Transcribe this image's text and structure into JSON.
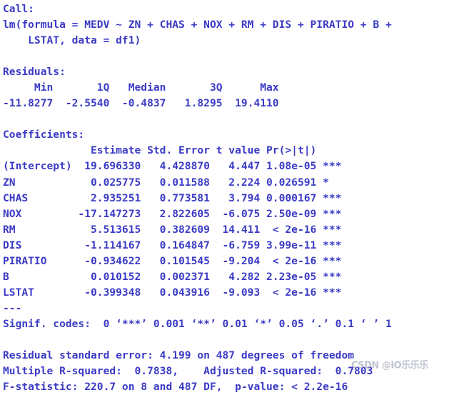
{
  "console": {
    "type": "r-console-output",
    "text_color": "#3b3bc6",
    "background_color": "#ffffff",
    "lines": [
      "Call:",
      "lm(formula = MEDV ~ ZN + CHAS + NOX + RM + DIS + PIRATIO + B +",
      "    LSTAT, data = df1)",
      "",
      "Residuals:",
      "     Min       1Q   Median       3Q      Max",
      "-11.8277  -2.5540  -0.4837   1.8295  19.4110",
      "",
      "Coefficients:",
      "              Estimate Std. Error t value Pr(>|t|)",
      "(Intercept)  19.696330   4.428870   4.447 1.08e-05 ***",
      "ZN            0.025775   0.011588   2.224 0.026591 *",
      "CHAS          2.935251   0.773581   3.794 0.000167 ***",
      "NOX         -17.147273   2.822605  -6.075 2.50e-09 ***",
      "RM            5.513615   0.382609  14.411  < 2e-16 ***",
      "DIS          -1.114167   0.164847  -6.759 3.99e-11 ***",
      "PIRATIO      -0.934622   0.101545  -9.204  < 2e-16 ***",
      "B             0.010152   0.002371   4.282 2.23e-05 ***",
      "LSTAT        -0.399348   0.043916  -9.093  < 2e-16 ***",
      "---",
      "Signif. codes:  0 ‘***’ 0.001 ‘**’ 0.01 ‘*’ 0.05 ‘.’ 0.1 ‘ ’ 1",
      "",
      "Residual standard error: 4.199 on 487 degrees of freedom",
      "Multiple R-squared:  0.7838,    Adjusted R-squared:  0.7803",
      "F-statistic: 220.7 on 8 and 487 DF,  p-value: < 2.2e-16"
    ]
  },
  "model_summary": {
    "call": {
      "label": "Call:",
      "formula": "lm(formula = MEDV ~ ZN + CHAS + NOX + RM + DIS + PIRATIO + B + LSTAT, data = df1)",
      "response": "MEDV",
      "predictors": [
        "ZN",
        "CHAS",
        "NOX",
        "RM",
        "DIS",
        "PIRATIO",
        "B",
        "LSTAT"
      ],
      "data": "df1"
    },
    "residuals": {
      "label": "Residuals:",
      "headers": [
        "Min",
        "1Q",
        "Median",
        "3Q",
        "Max"
      ],
      "values": [
        "-11.8277",
        "-2.5540",
        "-0.4837",
        "1.8295",
        "19.4110"
      ]
    },
    "coefficients": {
      "label": "Coefficients:",
      "headers": [
        "",
        "Estimate",
        "Std. Error",
        "t value",
        "Pr(>|t|)",
        ""
      ],
      "rows": [
        {
          "term": "(Intercept)",
          "estimate": "19.696330",
          "std_error": "4.428870",
          "t_value": "4.447",
          "p_value": "1.08e-05",
          "signif": "***"
        },
        {
          "term": "ZN",
          "estimate": "0.025775",
          "std_error": "0.011588",
          "t_value": "2.224",
          "p_value": "0.026591",
          "signif": "*"
        },
        {
          "term": "CHAS",
          "estimate": "2.935251",
          "std_error": "0.773581",
          "t_value": "3.794",
          "p_value": "0.000167",
          "signif": "***"
        },
        {
          "term": "NOX",
          "estimate": "-17.147273",
          "std_error": "2.822605",
          "t_value": "-6.075",
          "p_value": "2.50e-09",
          "signif": "***"
        },
        {
          "term": "RM",
          "estimate": "5.513615",
          "std_error": "0.382609",
          "t_value": "14.411",
          "p_value": "< 2e-16",
          "signif": "***"
        },
        {
          "term": "DIS",
          "estimate": "-1.114167",
          "std_error": "0.164847",
          "t_value": "-6.759",
          "p_value": "3.99e-11",
          "signif": "***"
        },
        {
          "term": "PIRATIO",
          "estimate": "-0.934622",
          "std_error": "0.101545",
          "t_value": "-9.204",
          "p_value": "< 2e-16",
          "signif": "***"
        },
        {
          "term": "B",
          "estimate": "0.010152",
          "std_error": "0.002371",
          "t_value": "4.282",
          "p_value": "2.23e-05",
          "signif": "***"
        },
        {
          "term": "LSTAT",
          "estimate": "-0.399348",
          "std_error": "0.043916",
          "t_value": "-9.093",
          "p_value": "< 2e-16",
          "signif": "***"
        }
      ]
    },
    "separator": "---",
    "signif_codes": "Signif. codes:  0 ‘***’ 0.001 ‘**’ 0.01 ‘*’ 0.05 ‘.’ 0.1 ‘ ’ 1",
    "statistics": {
      "residual_standard_error": "4.199",
      "residual_df": "487",
      "multiple_r_squared": "0.7838",
      "adjusted_r_squared": "0.7803",
      "f_statistic": "220.7",
      "f_df1": "8",
      "f_df2": "487",
      "p_value": "< 2.2e-16"
    }
  },
  "watermark": {
    "text": "CSDN @IO乐乐乐",
    "color": "#9aa0b4"
  }
}
